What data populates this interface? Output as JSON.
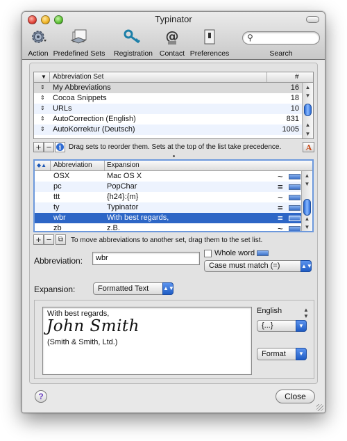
{
  "window": {
    "title": "Typinator"
  },
  "toolbar": {
    "items": [
      {
        "label": "Action",
        "icon": "gear-icon"
      },
      {
        "label": "Predefined Sets",
        "icon": "sets-icon"
      },
      {
        "label": "Registration",
        "icon": "key-icon"
      },
      {
        "label": "Contact",
        "icon": "at-sign-icon"
      },
      {
        "label": "Preferences",
        "icon": "switch-icon"
      }
    ],
    "search": {
      "label": "Search",
      "value": ""
    }
  },
  "sets_table": {
    "headers": {
      "name": "Abbreviation Set",
      "count": "#"
    },
    "rows": [
      {
        "name": "My Abbreviations",
        "count": "16"
      },
      {
        "name": "Cocoa Snippets",
        "count": "18"
      },
      {
        "name": "URLs",
        "count": "10"
      },
      {
        "name": "AutoCorrection (English)",
        "count": "831"
      },
      {
        "name": "AutoKorrektur (Deutsch)",
        "count": "1005"
      }
    ],
    "hint": "Drag sets to reorder them. Sets at the top of the list take precedence."
  },
  "abbr_table": {
    "headers": {
      "abbreviation": "Abbreviation",
      "expansion": "Expansion"
    },
    "rows": [
      {
        "abbr": "OSX",
        "expansion": "Mac OS X",
        "mode": "~"
      },
      {
        "abbr": "pc",
        "expansion": "PopChar",
        "mode": "="
      },
      {
        "abbr": "ttt",
        "expansion": "{h24}:{m}",
        "mode": "~"
      },
      {
        "abbr": "ty",
        "expansion": "Typinator",
        "mode": "="
      },
      {
        "abbr": "wbr",
        "expansion": "With best regards,",
        "mode": "="
      },
      {
        "abbr": "zb",
        "expansion": "z.B.",
        "mode": "~"
      }
    ],
    "hint": "To move abbreviations to another set, drag them to the set list."
  },
  "editor": {
    "abbreviation_label": "Abbreviation:",
    "abbreviation_value": "wbr",
    "whole_word_label": "Whole word",
    "case_option": "Case must match (=)",
    "expansion_label": "Expansion:",
    "expansion_type": "Formatted Text",
    "expansion_lines": {
      "line1": "With best regards,",
      "signature": "John Smith",
      "line3": "(Smith & Smith, Ltd.)"
    },
    "language": "English",
    "insert_menu": "{...}",
    "format_menu": "Format"
  },
  "footer": {
    "help": "?",
    "close": "Close"
  },
  "colors": {
    "selection": "#2d66c6",
    "accent": "#1f5cc4"
  }
}
